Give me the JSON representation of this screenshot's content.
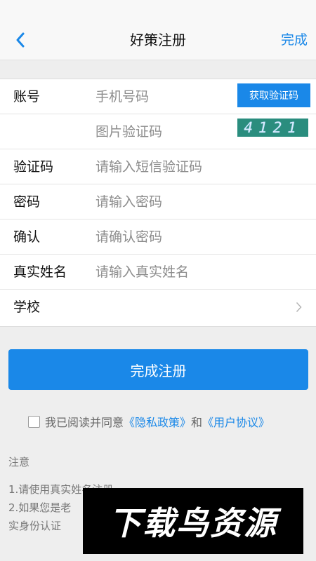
{
  "nav": {
    "title": "好策注册",
    "done_label": "完成"
  },
  "form": {
    "account": {
      "label": "账号",
      "placeholder": "手机号码",
      "get_code_label": "获取验证码"
    },
    "image_code": {
      "placeholder": "图片验证码",
      "captcha_text": "4121"
    },
    "sms_code": {
      "label": "验证码",
      "placeholder": "请输入短信验证码"
    },
    "password": {
      "label": "密码",
      "placeholder": "请输入密码"
    },
    "confirm": {
      "label": "确认",
      "placeholder": "请确认密码"
    },
    "real_name": {
      "label": "真实姓名",
      "placeholder": "请输入真实姓名"
    },
    "school": {
      "label": "学校"
    }
  },
  "submit_label": "完成注册",
  "agreement": {
    "checked": false,
    "prefix": "我已阅读并同意",
    "privacy_link": "《隐私政策》",
    "and": "和",
    "user_link": "《用户协议》"
  },
  "notes": {
    "title": "注意",
    "line1": "1.请使用真实姓名注册",
    "line2": "2.如果您是老",
    "line3": "实身份认证"
  },
  "watermark": "下载鸟资源",
  "colors": {
    "accent": "#1a88e8",
    "captcha_bg": "#2a8d7e"
  }
}
